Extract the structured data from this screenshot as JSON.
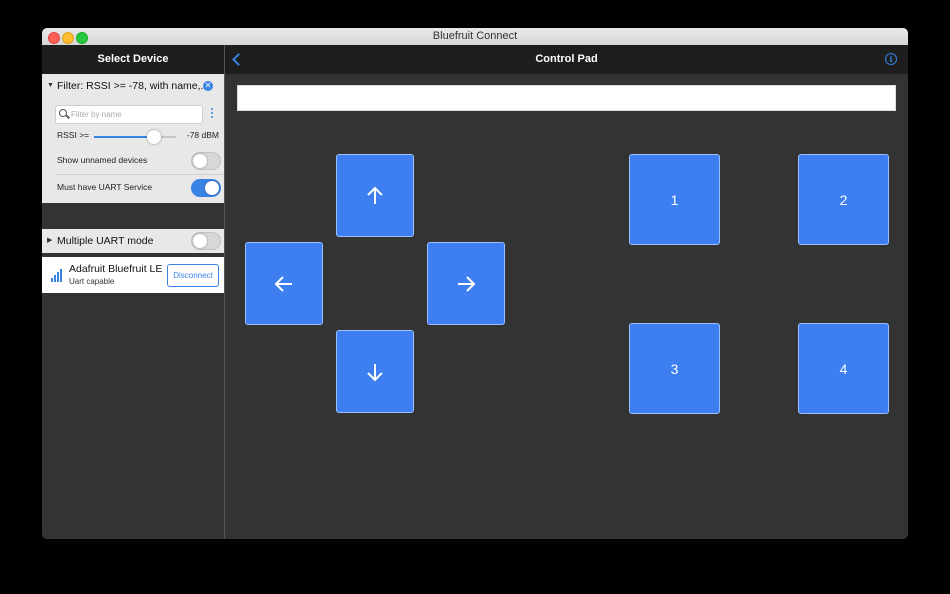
{
  "window": {
    "title": "Bluefruit Connect"
  },
  "sidebar": {
    "header": "Select Device",
    "filter": {
      "summary": "Filter: RSSI >= -78, with name,...",
      "search_placeholder": "Filter by name",
      "rssi_label": "RSSI >=",
      "rssi_value": "-78 dBM",
      "rssi_fraction": 0.73,
      "show_unnamed_label": "Show unnamed devices",
      "show_unnamed_on": false,
      "must_uart_label": "Must have UART Service",
      "must_uart_on": true
    },
    "uart_mode": {
      "label": "Multiple UART mode",
      "on": false
    },
    "device": {
      "name": "Adafruit Bluefruit LE",
      "subtitle": "Uart capable",
      "action": "Disconnect"
    }
  },
  "main": {
    "title": "Control Pad",
    "text_field_value": "",
    "dpad": {
      "up": "arrow-up-icon",
      "down": "arrow-down-icon",
      "left": "arrow-left-icon",
      "right": "arrow-right-icon"
    },
    "buttons": [
      "1",
      "2",
      "3",
      "4"
    ]
  },
  "colors": {
    "accent": "#3a83e4",
    "pad": "#3d7ff0"
  }
}
